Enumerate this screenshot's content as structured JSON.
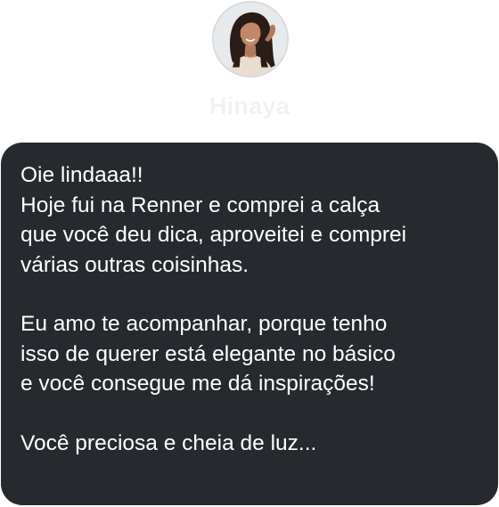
{
  "contact": {
    "name": "Hinaya"
  },
  "message": {
    "paragraphs": [
      {
        "lines": [
          "Oie lindaaa!!",
          "Hoje fui na Renner e comprei a calça",
          "que você deu dica, aproveitei e comprei",
          "várias outras coisinhas."
        ]
      },
      {
        "lines": [
          "Eu amo te acompanhar, porque tenho",
          "isso de querer está elegante no básico",
          "e você consegue me dá inspirações!"
        ]
      },
      {
        "lines": [
          "Você preciosa e cheia de luz..."
        ]
      }
    ]
  },
  "colors": {
    "bubble_background": "#262a2f",
    "message_text": "#ffffff",
    "name_text": "#f1f1f1",
    "page_background": "#ffffff"
  }
}
